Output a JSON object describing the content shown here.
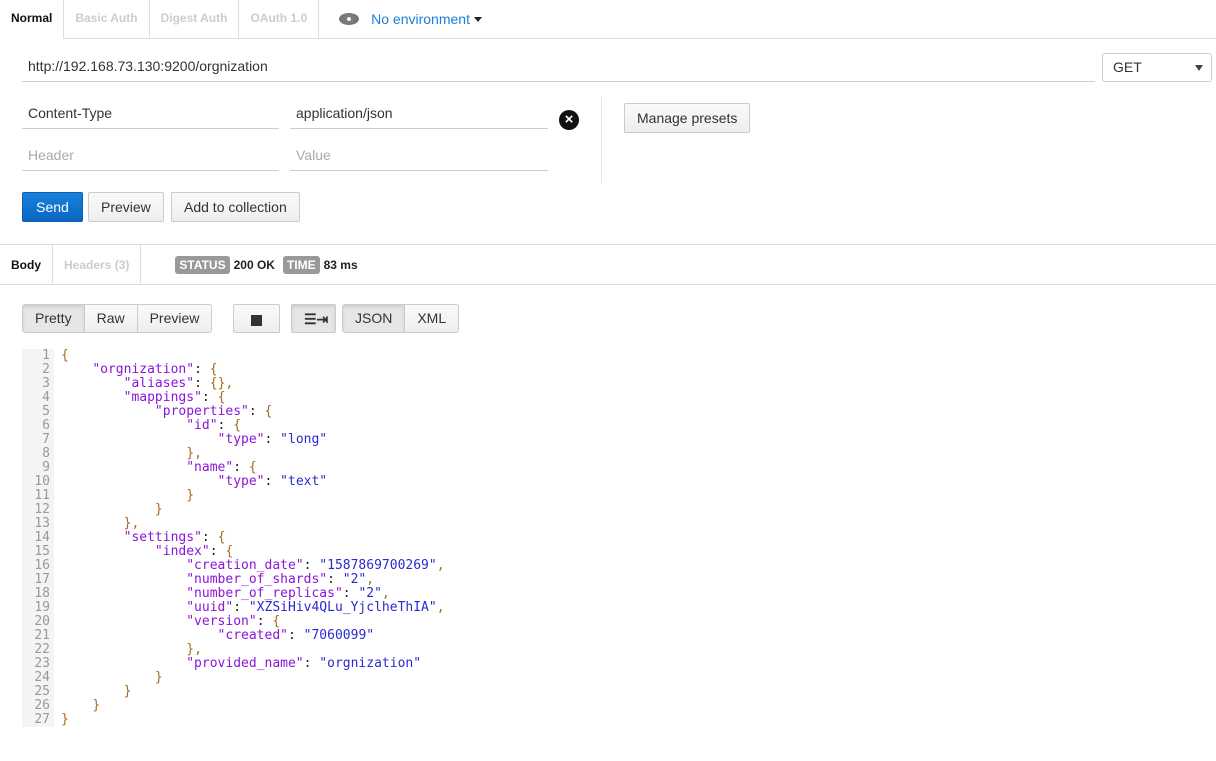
{
  "auth_tabs": [
    {
      "label": "Normal",
      "active": true
    },
    {
      "label": "Basic Auth"
    },
    {
      "label": "Digest Auth"
    },
    {
      "label": "OAuth 1.0"
    }
  ],
  "environment": {
    "icon": "eye-icon",
    "label": "No environment"
  },
  "request": {
    "url": "http://192.168.73.130:9200/orgnization",
    "method": "GET",
    "headers": [
      {
        "key": "Content-Type",
        "value": "application/json"
      }
    ],
    "header_placeholder": "Header",
    "value_placeholder": "Value",
    "manage_presets": "Manage presets",
    "send": "Send",
    "preview": "Preview",
    "add_to_collection": "Add to collection"
  },
  "response": {
    "tabs": [
      {
        "label": "Body",
        "active": true
      },
      {
        "label": "Headers (3)"
      }
    ],
    "status_label": "STATUS",
    "status": "200 OK",
    "time_label": "TIME",
    "time": "83 ms",
    "view_modes": [
      "Pretty",
      "Raw",
      "Preview"
    ],
    "active_view": "Pretty",
    "formats": [
      "JSON",
      "XML"
    ],
    "active_format": "JSON",
    "body_lines": [
      "{",
      "    \"orgnization\": {",
      "        \"aliases\": {},",
      "        \"mappings\": {",
      "            \"properties\": {",
      "                \"id\": {",
      "                    \"type\": \"long\"",
      "                },",
      "                \"name\": {",
      "                    \"type\": \"text\"",
      "                }",
      "            }",
      "        },",
      "        \"settings\": {",
      "            \"index\": {",
      "                \"creation_date\": \"1587869700269\",",
      "                \"number_of_shards\": \"2\",",
      "                \"number_of_replicas\": \"2\",",
      "                \"uuid\": \"XZSiHiv4QLu_YjclheThIA\",",
      "                \"version\": {",
      "                    \"created\": \"7060099\"",
      "                },",
      "                \"provided_name\": \"orgnization\"",
      "            }",
      "        }",
      "    }",
      "}"
    ]
  },
  "colors": {
    "accent": "#1c7ed6",
    "send": "#0966c2",
    "json_key": "#8a16d8",
    "json_string": "#2a2ad0",
    "json_punct": "#a86a1e"
  }
}
